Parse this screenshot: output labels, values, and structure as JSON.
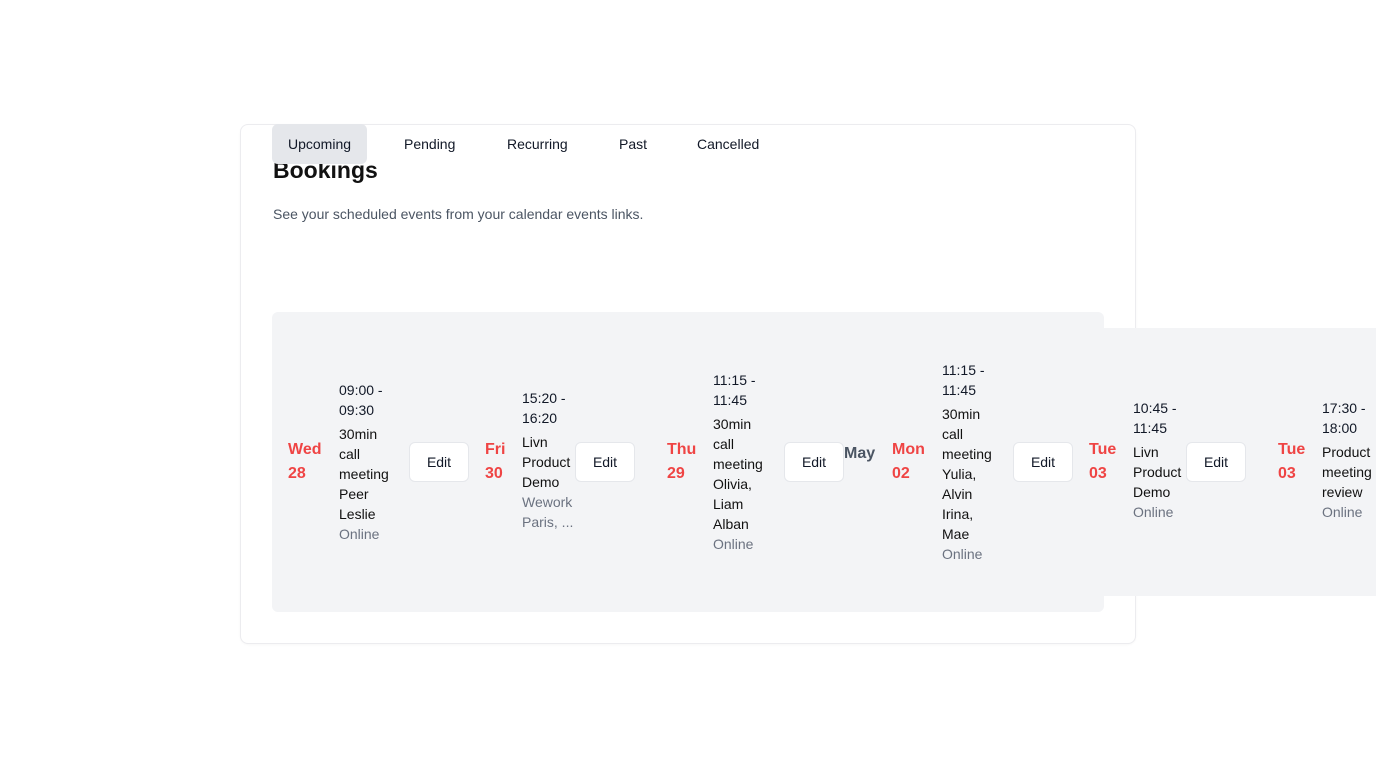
{
  "page": {
    "title": "Bookings",
    "subtitle": "See your scheduled events from your calendar events links."
  },
  "tabs": [
    {
      "label": "Upcoming",
      "active": true
    },
    {
      "label": "Pending",
      "active": false
    },
    {
      "label": "Recurring",
      "active": false
    },
    {
      "label": "Past",
      "active": false
    },
    {
      "label": "Cancelled",
      "active": false
    }
  ],
  "month_label": "May",
  "bookings": [
    {
      "day": "Wed",
      "date": "28",
      "time": "09:00 - 09:30",
      "title": "30min call meeting Peer Leslie",
      "location": "Online",
      "edit_label": "Edit"
    },
    {
      "day": "Fri",
      "date": "30",
      "time": "15:20 - 16:20",
      "title": "Livn Product Demo",
      "location": "Wework Paris, ...",
      "edit_label": "Edit"
    },
    {
      "day": "Thu",
      "date": "29",
      "time": "11:15 - 11:45",
      "title": "30min call meeting Olivia, Liam Alban",
      "location": "Online",
      "edit_label": "Edit"
    },
    {
      "day": "Mon",
      "date": "02",
      "time": "11:15 - 11:45",
      "title": "30min call meeting Yulia, Alvin Irina, Mae",
      "location": "Online",
      "edit_label": "Edit"
    },
    {
      "day": "Tue",
      "date": "03",
      "time": "10:45 - 11:45",
      "title": "Livn Product Demo",
      "location": "Online",
      "edit_label": "Edit"
    },
    {
      "day": "Tue",
      "date": "03",
      "time": "17:30 - 18:00",
      "title": "Product meeting review",
      "location": "Online",
      "edit_label": ""
    }
  ],
  "colors": {
    "accent_date": "#ef4444",
    "tab_active_bg": "#e5e7eb",
    "panel_bg": "#f3f4f6"
  }
}
